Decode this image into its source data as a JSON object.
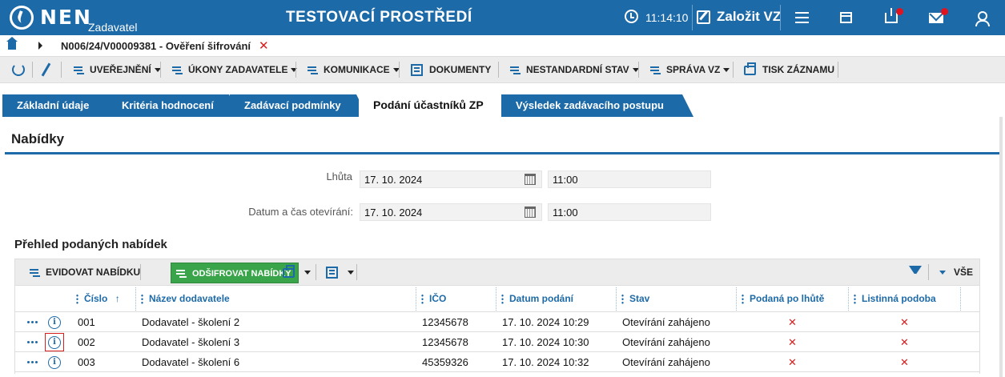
{
  "header": {
    "logo": "NEN",
    "logo_sub": "Zadavatel",
    "env_title": "TESTOVACÍ PROSTŘEDÍ",
    "clock": "11:14:10",
    "create_label": "Založit VZ"
  },
  "breadcrumb": {
    "path": "N006/24/V00009381 - Ověření šifrování"
  },
  "toolbar": {
    "items": [
      "UVEŘEJNĚNÍ",
      "ÚKONY ZADAVATELE",
      "KOMUNIKACE",
      "DOKUMENTY",
      "NESTANDARDNÍ STAV",
      "SPRÁVA VZ",
      "TISK ZÁZNAMU"
    ]
  },
  "tabs": [
    "Základní údaje",
    "Kritéria hodnocení",
    "Zadávací podmínky",
    "Podání účastníků ZP",
    "Výsledek zadávacího postupu"
  ],
  "section": {
    "title": "Nabídky",
    "deadline_label": "Lhůta",
    "deadline_date": "17. 10. 2024",
    "deadline_time": "11:00",
    "opening_label": "Datum a čas otevírání:",
    "opening_date": "17. 10. 2024",
    "opening_time": "11:00",
    "list_title": "Přehled podaných nabídek"
  },
  "grid": {
    "btn_register": "EVIDOVAT NABÍDKU",
    "btn_decrypt": "ODŠIFROVAT NABÍDKY",
    "filter_all": "VŠE",
    "columns": [
      "Číslo",
      "Název dodavatele",
      "IČO",
      "Datum podání",
      "Stav",
      "Podaná po lhůtě",
      "Listinná podoba"
    ],
    "sort_indicator": "↑",
    "rows": [
      {
        "cislo": "001",
        "nazev": "Dodavatel - školení 2",
        "ico": "12345678",
        "datum": "17. 10. 2024 10:29",
        "stav": "Otevírání zahájeno",
        "po_lhute": "✕",
        "listinna": "✕"
      },
      {
        "cislo": "002",
        "nazev": "Dodavatel - školení 3",
        "ico": "12345678",
        "datum": "17. 10. 2024 10:30",
        "stav": "Otevírání zahájeno",
        "po_lhute": "✕",
        "listinna": "✕"
      },
      {
        "cislo": "003",
        "nazev": "Dodavatel - školení 6",
        "ico": "45359326",
        "datum": "17. 10. 2024 10:32",
        "stav": "Otevírání zahájeno",
        "po_lhute": "✕",
        "listinna": "✕"
      }
    ]
  },
  "colors": {
    "brand": "#1d6aa8",
    "success": "#3aa44a",
    "danger": "#d81e1e"
  },
  "info_glyph": "i"
}
